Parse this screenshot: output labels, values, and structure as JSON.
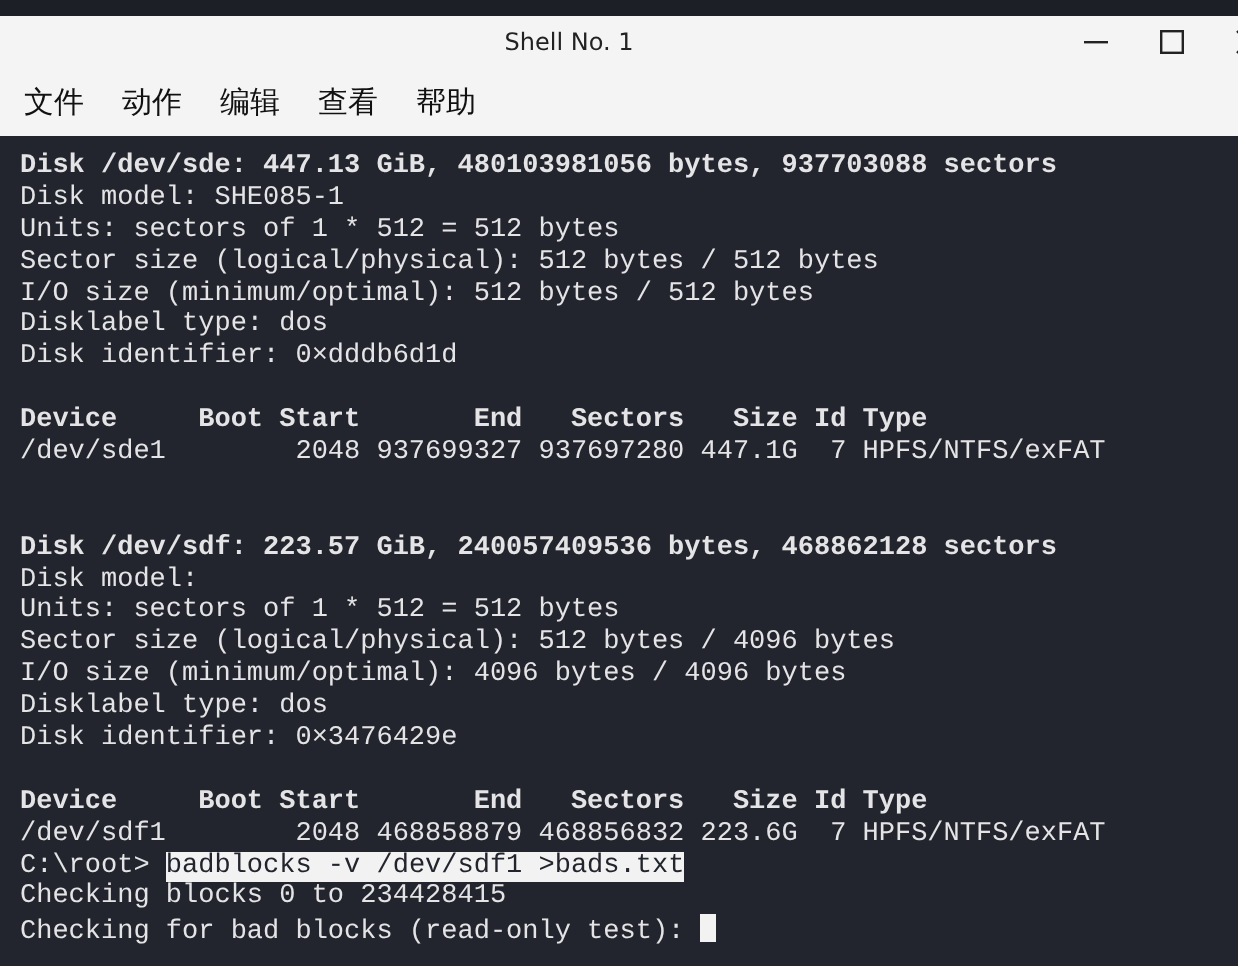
{
  "window": {
    "title": "Shell No. 1"
  },
  "menu": [
    "文件",
    "动作",
    "编辑",
    "查看",
    "帮助"
  ],
  "terminal": {
    "lines": [
      {
        "kind": "text",
        "text": "Disk /dev/sde: 447.13 GiB, 480103981056 bytes, 937703088 sectors",
        "bold": true
      },
      {
        "kind": "text",
        "text": "Disk model: SHE085-1",
        "bold": false
      },
      {
        "kind": "text",
        "text": "Units: sectors of 1 * 512 = 512 bytes",
        "bold": false
      },
      {
        "kind": "text",
        "text": "Sector size (logical/physical): 512 bytes / 512 bytes",
        "bold": false
      },
      {
        "kind": "text",
        "text": "I/O size (minimum/optimal): 512 bytes / 512 bytes",
        "bold": false
      },
      {
        "kind": "text",
        "text": "Disklabel type: dos",
        "bold": false
      },
      {
        "kind": "text",
        "text": "Disk identifier: 0×dddb6d1d",
        "bold": false
      },
      {
        "kind": "blank"
      },
      {
        "kind": "text",
        "text": "Device     Boot Start       End   Sectors   Size Id Type",
        "bold": true
      },
      {
        "kind": "text",
        "text": "/dev/sde1        2048 937699327 937697280 447.1G  7 HPFS/NTFS/exFAT",
        "bold": false
      },
      {
        "kind": "blank"
      },
      {
        "kind": "blank"
      },
      {
        "kind": "text",
        "text": "Disk /dev/sdf: 223.57 GiB, 240057409536 bytes, 468862128 sectors",
        "bold": true
      },
      {
        "kind": "text",
        "text": "Disk model:",
        "bold": false
      },
      {
        "kind": "text",
        "text": "Units: sectors of 1 * 512 = 512 bytes",
        "bold": false
      },
      {
        "kind": "text",
        "text": "Sector size (logical/physical): 512 bytes / 4096 bytes",
        "bold": false
      },
      {
        "kind": "text",
        "text": "I/O size (minimum/optimal): 4096 bytes / 4096 bytes",
        "bold": false
      },
      {
        "kind": "text",
        "text": "Disklabel type: dos",
        "bold": false
      },
      {
        "kind": "text",
        "text": "Disk identifier: 0×3476429e",
        "bold": false
      },
      {
        "kind": "blank"
      },
      {
        "kind": "text",
        "text": "Device     Boot Start       End   Sectors   Size Id Type",
        "bold": true
      },
      {
        "kind": "text",
        "text": "/dev/sdf1        2048 468858879 468856832 223.6G  7 HPFS/NTFS/exFAT",
        "bold": false
      },
      {
        "kind": "prompt",
        "prompt": "C:\\root>",
        "command": "badblocks -v /dev/sdf1 >bads.txt"
      },
      {
        "kind": "text",
        "text": "Checking blocks 0 to 234428415",
        "bold": false
      },
      {
        "kind": "text",
        "text": "Checking for bad blocks (read-only test):",
        "bold": false,
        "cursor": true
      }
    ]
  }
}
